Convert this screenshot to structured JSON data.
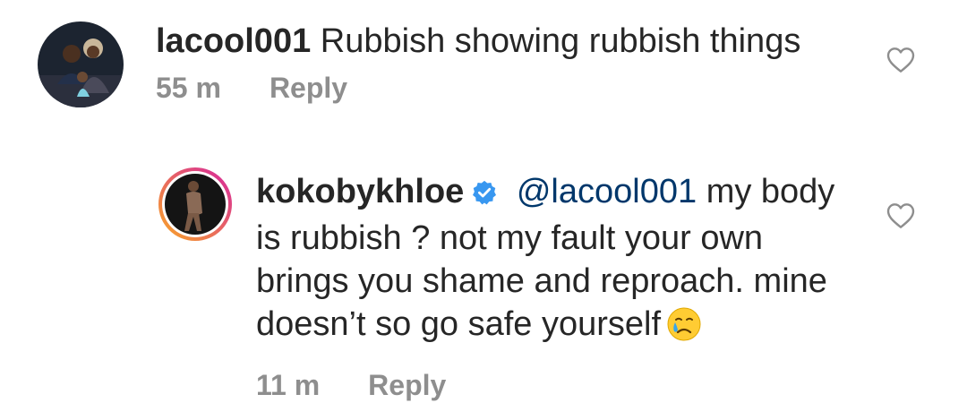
{
  "comments": [
    {
      "username": "lacool001",
      "text": "Rubbish showing rubbish things",
      "time": "55 m",
      "reply_label": "Reply",
      "avatar": "family-photo-avatar",
      "like_icon": "heart-outline-icon"
    },
    {
      "username": "kokobykhloe",
      "verified": true,
      "mention": "@lacool001",
      "text_line1": "my body",
      "text_line2": "is rubbish ? not my fault your own",
      "text_line3": "brings you shame and reproach. mine",
      "text_line4": "doesn’t so go safe yourself",
      "emoji": "crying-face-emoji",
      "time": "11 m",
      "reply_label": "Reply",
      "avatar": "story-ring-avatar",
      "like_icon": "heart-outline-icon"
    }
  ],
  "colors": {
    "text": "#262626",
    "meta": "#8e8e8e",
    "mention": "#00376b",
    "verified": "#3897f0",
    "story_ring_start": "#f9a825",
    "story_ring_end": "#d6249f"
  }
}
